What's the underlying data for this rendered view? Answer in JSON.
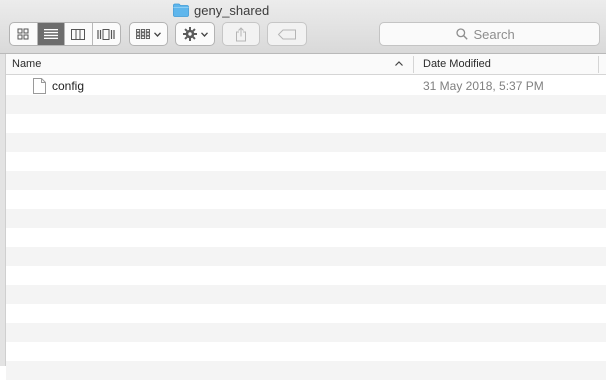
{
  "window": {
    "title": "geny_shared"
  },
  "toolbar": {
    "view_modes": [
      {
        "name": "icon-view",
        "active": false
      },
      {
        "name": "list-view",
        "active": true
      },
      {
        "name": "column-view",
        "active": false
      },
      {
        "name": "cover-flow-view",
        "active": false
      }
    ],
    "group_button_icon": "group-grid-icon",
    "action_button_icon": "gear-icon",
    "share_button_icon": "share-icon",
    "tag_button_icon": "tag-icon",
    "search_placeholder": "Search"
  },
  "list": {
    "columns": {
      "name": "Name",
      "date_modified": "Date Modified"
    },
    "sort": {
      "column": "Name",
      "direction": "ascending"
    },
    "files": [
      {
        "name": "config",
        "date_modified": "31 May 2018, 5:37 PM",
        "icon": "document-icon"
      }
    ]
  }
}
